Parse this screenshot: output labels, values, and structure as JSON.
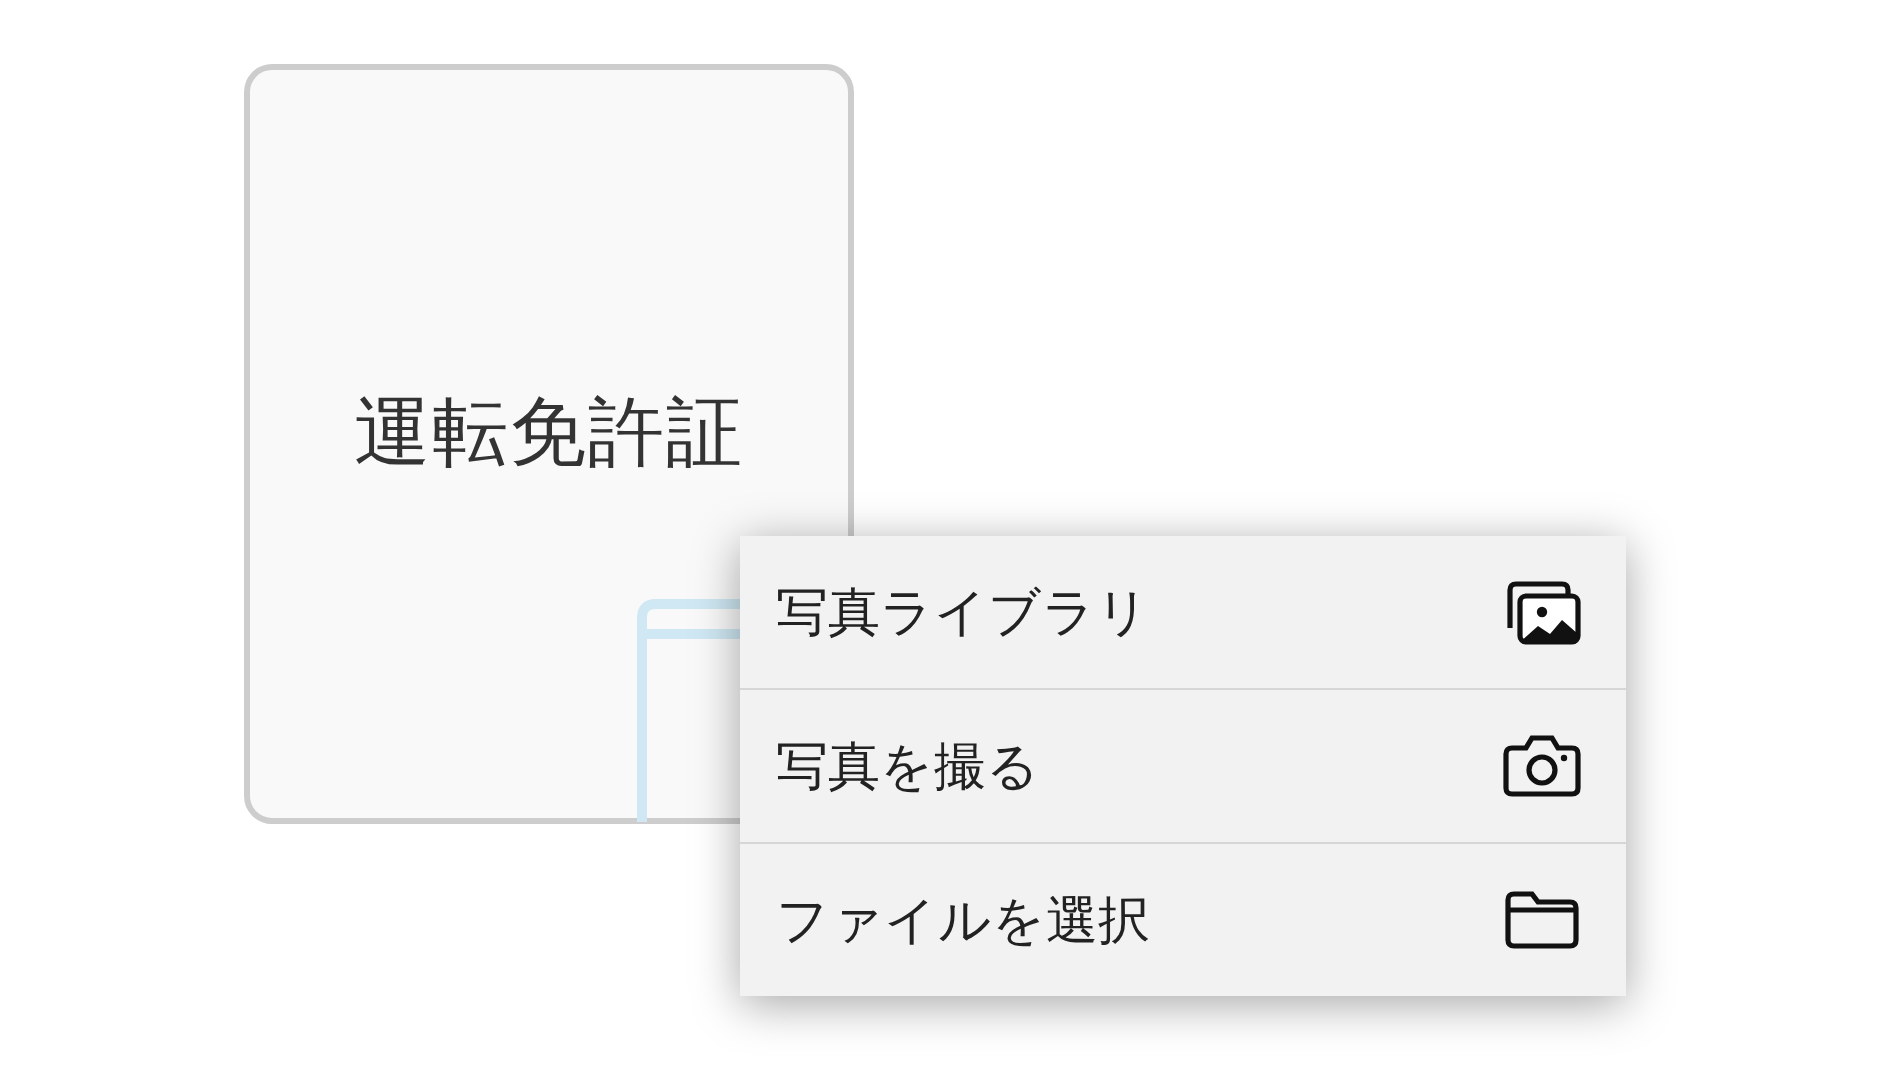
{
  "card": {
    "label": "運転免許証"
  },
  "menu": {
    "items": [
      {
        "label": "写真ライブラリ",
        "kind": "photos"
      },
      {
        "label": "写真を撮る",
        "kind": "camera"
      },
      {
        "label": "ファイルを選択",
        "kind": "folder"
      }
    ]
  }
}
